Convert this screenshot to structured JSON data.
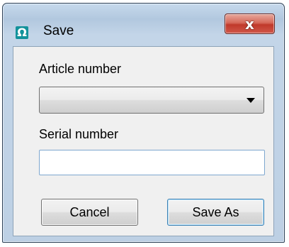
{
  "window": {
    "title": "Save",
    "app_icon": "omega-icon",
    "app_icon_glyph": "Ω",
    "close_glyph": "x"
  },
  "form": {
    "article_label": "Article number",
    "article_value": "",
    "serial_label": "Serial number",
    "serial_value": "",
    "serial_placeholder": ""
  },
  "buttons": {
    "cancel_label": "Cancel",
    "save_as_label": "Save As"
  },
  "colors": {
    "titlebar": "#b8cde3",
    "close_button": "#c0392b",
    "app_icon": "#12929b",
    "client_background": "#f0f0f0",
    "default_button_border": "#3c7fb1"
  }
}
